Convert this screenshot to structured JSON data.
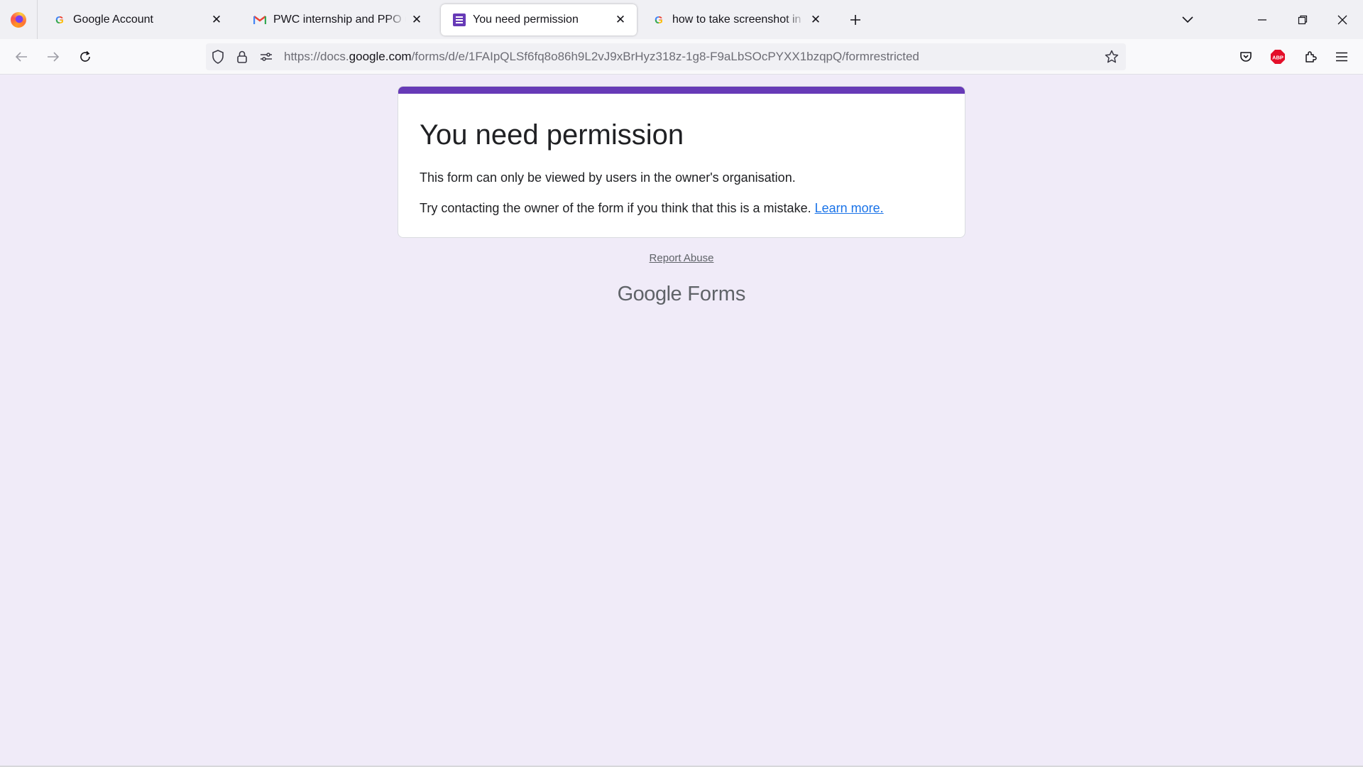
{
  "tabs": [
    {
      "title": "Google Account",
      "favicon": "google-icon",
      "active": false
    },
    {
      "title": "PWC internship and PPO update",
      "favicon": "gmail-icon",
      "active": false
    },
    {
      "title": "You need permission",
      "favicon": "google-forms-icon",
      "active": true
    },
    {
      "title": "how to take screenshot in laptop",
      "favicon": "google-icon",
      "active": false
    }
  ],
  "url": {
    "prefix": "https://docs.",
    "host": "google.com",
    "path": "/forms/d/e/1FAIpQLSf6fq8o86h9L2vJ9xBrHyz318z-1g8-F9aLbSOcPYXX1bzqpQ/formrestricted"
  },
  "page": {
    "title": "You need permission",
    "message": "This form can only be viewed by users in the owner's organisation.",
    "hint": "Try contacting the owner of the form if you think that this is a mistake.",
    "learn_more": "Learn more.",
    "report_abuse": "Report Abuse",
    "brand_google": "Google",
    "brand_product": "Forms"
  },
  "colors": {
    "accent": "#673ab7",
    "page_bg": "#f0ebf8",
    "link": "#1a73e8"
  },
  "toolbar_icons": [
    "pocket-icon",
    "adblock-icon",
    "extensions-icon",
    "menu-icon"
  ]
}
